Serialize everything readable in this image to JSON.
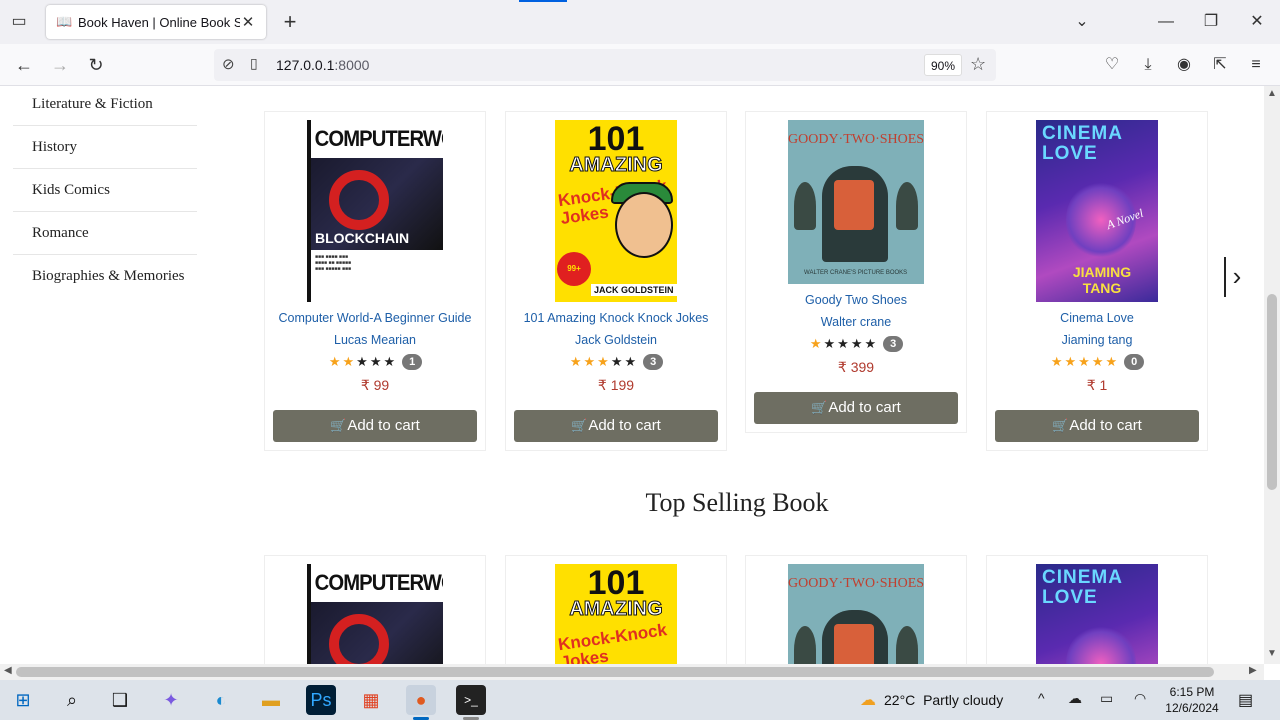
{
  "browser": {
    "tab_title": "Book Haven | Online Book Stor",
    "url_host": "127.0.0.1",
    "url_port": ":8000",
    "zoom": "90%"
  },
  "sidebar": {
    "categories": [
      "Literature & Fiction",
      "History",
      "Kids Comics",
      "Romance",
      "Biographies & Memories"
    ]
  },
  "books": [
    {
      "title": "Computer World-A Beginner Guide",
      "author": "Lucas Mearian",
      "rating": 2,
      "review_count": "1",
      "price": "₹ 99",
      "cover": "computerworld"
    },
    {
      "title": "101 Amazing Knock Knock Jokes",
      "author": "Jack Goldstein",
      "rating": 3,
      "review_count": "3",
      "price": "₹ 199",
      "cover": "amazing-jokes"
    },
    {
      "title": "Goody Two Shoes",
      "author": "Walter crane",
      "rating": 1,
      "review_count": "3",
      "price": "₹ 399",
      "cover": "goody-two-shoes"
    },
    {
      "title": "Cinema Love",
      "author": "Jiaming tang",
      "rating": 5,
      "review_count": "0",
      "price": "₹ 1",
      "cover": "cinema-love"
    }
  ],
  "add_to_cart_label": "Add to cart",
  "section_title": "Top Selling Book",
  "covers": {
    "computerworld": {
      "masthead": "COMPUTERWORLD",
      "headline": "BLOCKCHAIN"
    },
    "amazing_jokes": {
      "number": "101",
      "word": "AMAZING",
      "sub": "Knock-Knock Jokes",
      "badge": "99+ HILARIOUS",
      "author": "JACK GOLDSTEIN"
    },
    "goody": {
      "title": "GOODY·TWO·SHOES",
      "series": "WALTER CRANE'S PICTURE BOOKS"
    },
    "cinema": {
      "title": "CINEMA LOVE",
      "tag": "A Novel",
      "author": "JIAMING TANG"
    }
  },
  "taskbar": {
    "temperature": "22°C",
    "weather": "Partly cloudy",
    "time": "6:15 PM",
    "date": "12/6/2024"
  },
  "colors": {
    "star_on": "#f7a21b",
    "price": "#b03a2e",
    "link": "#1e5fa8",
    "button": "#6e6e62"
  }
}
